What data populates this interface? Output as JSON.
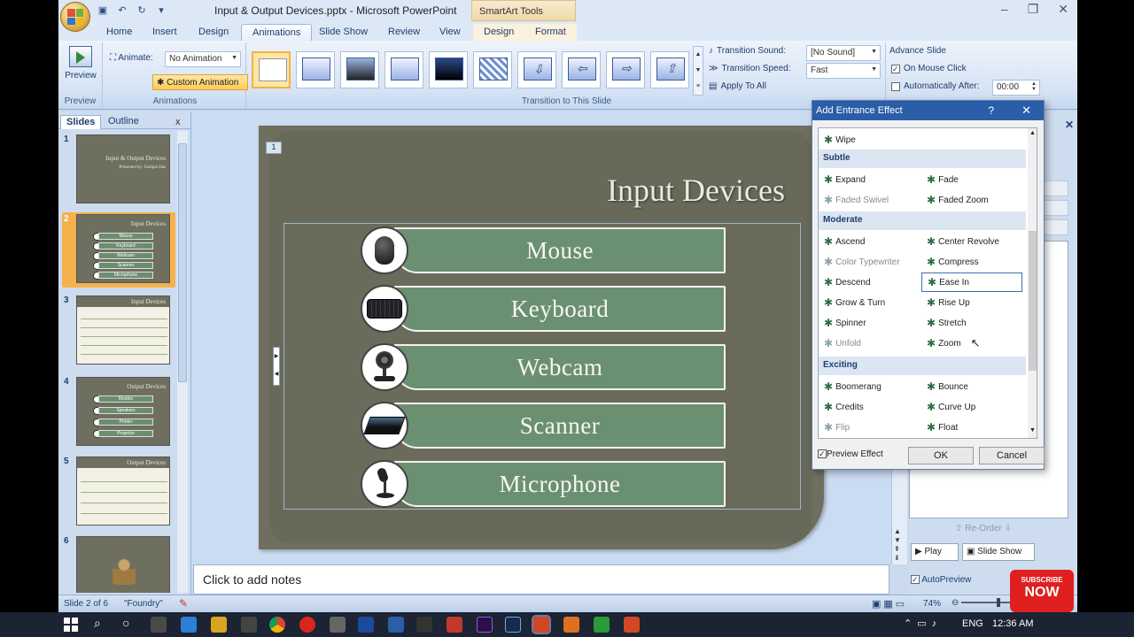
{
  "window": {
    "title": "Input & Output Devices.pptx - Microsoft PowerPoint",
    "contextual_tab_group": "SmartArt Tools"
  },
  "tabs": [
    "Home",
    "Insert",
    "Design",
    "Animations",
    "Slide Show",
    "Review",
    "View",
    "Design",
    "Format"
  ],
  "ribbon": {
    "preview_label": "Preview",
    "preview_group": "Preview",
    "animate_label": "Animate:",
    "animate_value": "No Animation",
    "custom_animation": "Custom Animation",
    "animations_group": "Animations",
    "transition_group": "Transition to This Slide",
    "transition_sound_label": "Transition Sound:",
    "transition_sound_value": "[No Sound]",
    "transition_speed_label": "Transition Speed:",
    "transition_speed_value": "Fast",
    "apply_to_all": "Apply To All",
    "advance_slide": "Advance Slide",
    "on_mouse_click": "On Mouse Click",
    "automatically_after": "Automatically After:",
    "auto_time": "00:00"
  },
  "left_panel": {
    "tab_slides": "Slides",
    "tab_outline": "Outline",
    "close": "x",
    "slides": [
      {
        "num": "1",
        "title": "Input & Output Devices",
        "subtitle": "Presented by: Sudipta Das"
      },
      {
        "num": "2",
        "title": "Input Devices",
        "items": [
          "Mouse",
          "Keyboard",
          "Webcam",
          "Scanner",
          "Microphone"
        ]
      },
      {
        "num": "3",
        "title": "Input Devices"
      },
      {
        "num": "4",
        "title": "Output Devices",
        "items": [
          "Monitor",
          "Speakers",
          "Printer",
          "Projector"
        ]
      },
      {
        "num": "5",
        "title": "Output Devices"
      },
      {
        "num": "6",
        "title": ""
      }
    ]
  },
  "slide": {
    "number": "1",
    "title": "Input Devices",
    "items": [
      "Mouse",
      "Keyboard",
      "Webcam",
      "Scanner",
      "Microphone"
    ]
  },
  "notes_placeholder": "Click to add notes",
  "dialog": {
    "title": "Add Entrance Effect",
    "help": "?",
    "close": "✕",
    "top_item": "Wipe",
    "categories": [
      {
        "name": "Subtle",
        "effects": [
          [
            "Expand",
            "Fade"
          ],
          [
            "Faded Swivel",
            "Faded Zoom"
          ]
        ]
      },
      {
        "name": "Moderate",
        "effects": [
          [
            "Ascend",
            "Center Revolve"
          ],
          [
            "Color Typewriter",
            "Compress"
          ],
          [
            "Descend",
            "Ease In"
          ],
          [
            "Grow & Turn",
            "Rise Up"
          ],
          [
            "Spinner",
            "Stretch"
          ],
          [
            "Unfold",
            "Zoom"
          ]
        ]
      },
      {
        "name": "Exciting",
        "effects": [
          [
            "Boomerang",
            "Bounce"
          ],
          [
            "Credits",
            "Curve Up"
          ],
          [
            "Flip",
            "Float"
          ]
        ]
      }
    ],
    "preview_effect": "Preview Effect",
    "ok": "OK",
    "cancel": "Cancel"
  },
  "right_pane": {
    "reorder": "Re-Order",
    "play": "Play",
    "slide_show": "Slide Show",
    "autopreview": "AutoPreview"
  },
  "status": {
    "slide_info": "Slide 2 of 6",
    "theme": "\"Foundry\"",
    "zoom": "74%"
  },
  "taskbar": {
    "lang": "ENG",
    "time": "12:36 AM"
  },
  "overlay": {
    "subscribe": "SUBSCRIBE",
    "now": "NOW"
  },
  "colors": {
    "ribbon_blue": "#c9d9ee",
    "slide_bg": "#6e6f5f",
    "band_green": "#6b9071",
    "dialog_title": "#2b5ea8",
    "selected_orange": "#f7b14a",
    "youtube_red": "#e01f1f"
  }
}
